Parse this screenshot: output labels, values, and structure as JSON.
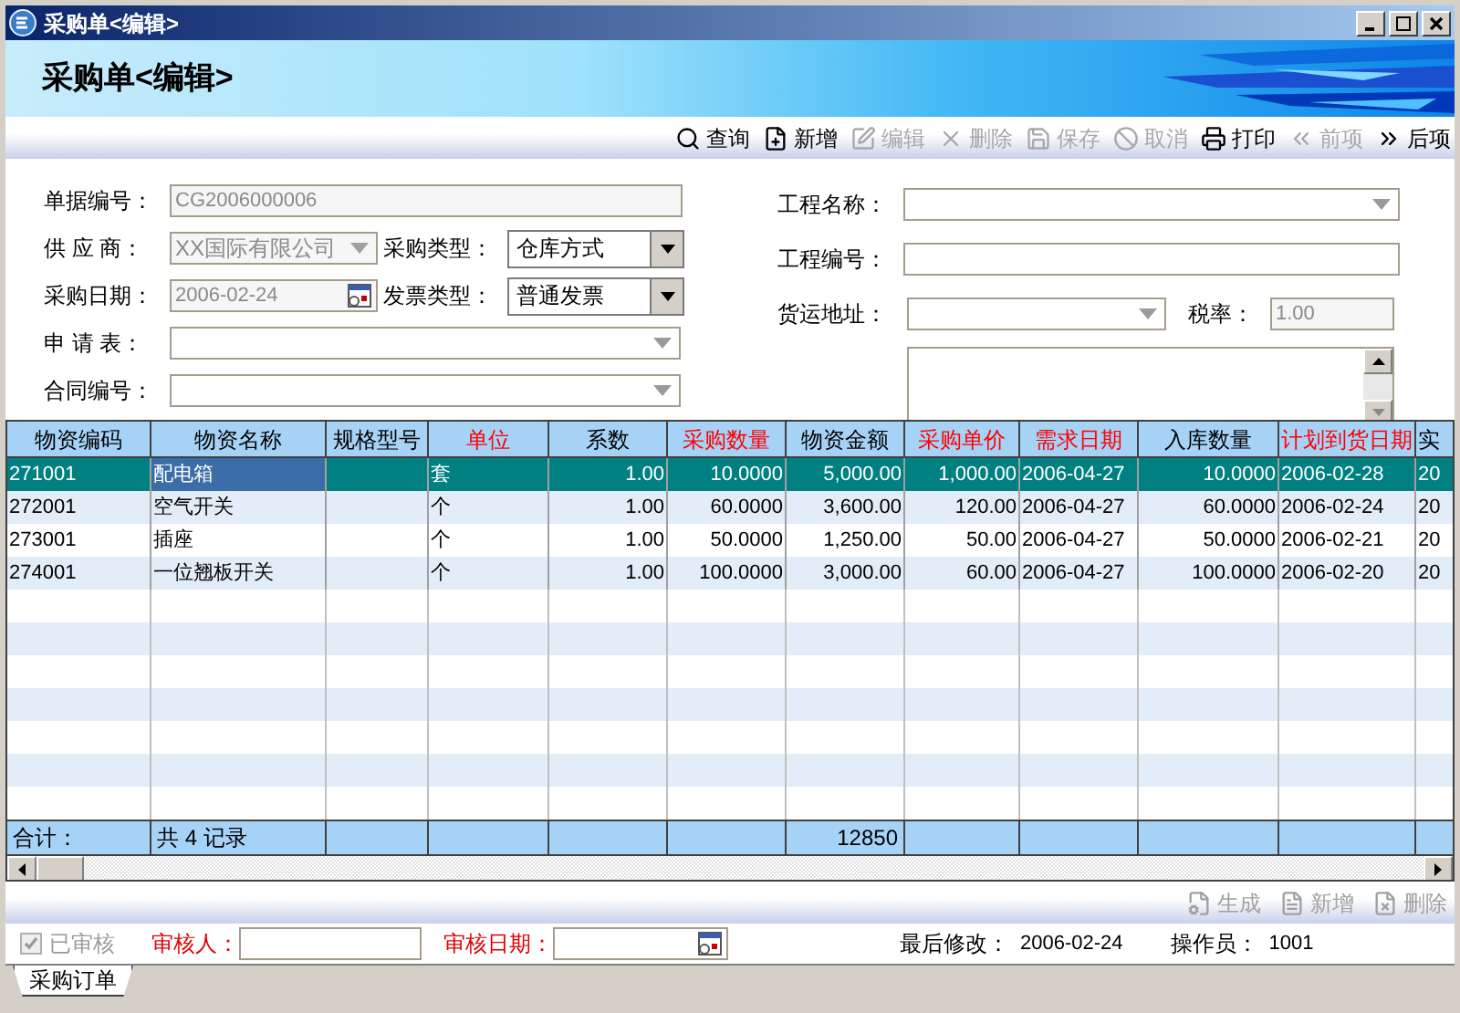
{
  "window": {
    "title": "采购单<编辑>"
  },
  "banner": {
    "title": "采购单<编辑>"
  },
  "toolbar": [
    {
      "label": "查询",
      "disabled": false
    },
    {
      "label": "新增",
      "disabled": false
    },
    {
      "label": "编辑",
      "disabled": true
    },
    {
      "label": "删除",
      "disabled": true
    },
    {
      "label": "保存",
      "disabled": true
    },
    {
      "label": "取消",
      "disabled": true
    },
    {
      "label": "打印",
      "disabled": false
    },
    {
      "label": "前项",
      "disabled": true
    },
    {
      "label": "后项",
      "disabled": false
    }
  ],
  "form": {
    "fields": [
      {
        "label": "单据编号：",
        "kind": "text",
        "value": "CG2006000006",
        "disabled": true
      },
      {
        "label": "供 应 商：",
        "kind": "combo",
        "value": "XX国际有限公司",
        "disabled": true
      },
      {
        "label": "采购类型：",
        "kind": "select",
        "value": "仓库方式",
        "disabled": false
      },
      {
        "label": "采购日期：",
        "kind": "date",
        "value": "2006-02-24",
        "disabled": true
      },
      {
        "label": "发票类型：",
        "kind": "select",
        "value": "普通发票",
        "disabled": false
      },
      {
        "label": "申 请 表：",
        "kind": "combo"
      },
      {
        "label": "合同编号：",
        "kind": "combo"
      },
      {
        "label": "工程名称：",
        "kind": "combo"
      },
      {
        "label": "工程编号：",
        "kind": "text"
      },
      {
        "label": "货运地址：",
        "kind": "combo"
      },
      {
        "label": "税率：",
        "kind": "text",
        "value": "1.00",
        "disabled": true
      },
      {
        "kind": "memo",
        "disabled": false
      }
    ]
  },
  "table": {
    "columns": [
      {
        "label": "物资编码",
        "required": false,
        "kind": "text",
        "current": false
      },
      {
        "label": "物资名称",
        "required": false,
        "kind": "text",
        "current": true
      },
      {
        "label": "规格型号",
        "required": false,
        "kind": "text",
        "current": false
      },
      {
        "label": "单位",
        "required": true,
        "kind": "text",
        "current": false
      },
      {
        "label": "系数",
        "required": false,
        "kind": "number",
        "current": false
      },
      {
        "label": "采购数量",
        "required": true,
        "kind": "number",
        "current": false
      },
      {
        "label": "物资金额",
        "required": false,
        "kind": "number",
        "current": false
      },
      {
        "label": "采购单价",
        "required": true,
        "kind": "number",
        "current": false
      },
      {
        "label": "需求日期",
        "required": true,
        "kind": "text",
        "current": false
      },
      {
        "label": "入库数量",
        "required": false,
        "kind": "number",
        "current": false
      },
      {
        "label": "计划到货日期",
        "required": true,
        "kind": "text",
        "current": false
      },
      {
        "label": "实",
        "required": false,
        "kind": "text",
        "current": false
      }
    ],
    "rows": [
      {
        "selected": true,
        "cells": [
          "271001",
          "配电箱",
          null,
          "套",
          "1.00",
          "10.0000",
          "5,000.00",
          "1,000.00",
          "2006-04-27",
          "10.0000",
          "2006-02-28",
          "20"
        ]
      },
      {
        "selected": false,
        "cells": [
          "272001",
          "空气开关",
          null,
          "个",
          "1.00",
          "60.0000",
          "3,600.00",
          "120.00",
          "2006-04-27",
          "60.0000",
          "2006-02-24",
          "20"
        ]
      },
      {
        "selected": false,
        "cells": [
          "273001",
          "插座",
          null,
          "个",
          "1.00",
          "50.0000",
          "1,250.00",
          "50.00",
          "2006-04-27",
          "50.0000",
          "2006-02-21",
          "20"
        ]
      },
      {
        "selected": false,
        "cells": [
          "274001",
          "一位翘板开关",
          null,
          "个",
          "1.00",
          "100.0000",
          "3,000.00",
          "60.00",
          "2006-04-27",
          "100.0000",
          "2006-02-20",
          "20"
        ]
      }
    ],
    "totals": {
      "label": "合计：",
      "count": "共 4 记录",
      "amount": "12850"
    }
  },
  "detail_toolbar": [
    {
      "label": "生成",
      "disabled": true
    },
    {
      "label": "新增",
      "disabled": true
    },
    {
      "label": "删除",
      "disabled": true
    }
  ],
  "footer": {
    "approved": {
      "label": "已审核",
      "checked": true,
      "disabled": true
    },
    "reviewer_label": "审核人：",
    "review_date_label": "审核日期：",
    "modified_label": "最后修改：",
    "modified": "2006-02-24",
    "operator_label": "操作员：",
    "operator": "1001"
  },
  "tabs": [
    {
      "label": "采购订单",
      "selected": true
    }
  ]
}
